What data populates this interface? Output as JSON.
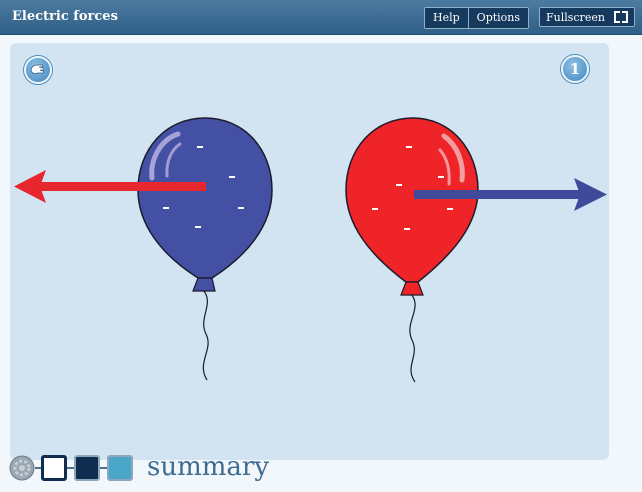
{
  "header": {
    "title": "Electric forces",
    "buttons": {
      "help": "Help",
      "options": "Options",
      "fullscreen": "Fullscreen"
    }
  },
  "stage": {
    "step_number": "1",
    "balloons": [
      {
        "name": "left",
        "color": "#4450a3",
        "charges": [
          "-",
          "-",
          "-",
          "-",
          "-"
        ],
        "arrow_color": "#e8262d",
        "arrow_direction": "left"
      },
      {
        "name": "right",
        "color": "#ee2428",
        "charges": [
          "-",
          "-",
          "-",
          "-",
          "-",
          "-"
        ],
        "arrow_color": "#3f4a9a",
        "arrow_direction": "right"
      }
    ]
  },
  "nav": {
    "summary_label": "summary"
  },
  "colors": {
    "header": "#2f5f87",
    "stage_bg": "#d2e4f1",
    "nav_dark": "#0f2d4f",
    "nav_light": "#4aa7c9"
  }
}
